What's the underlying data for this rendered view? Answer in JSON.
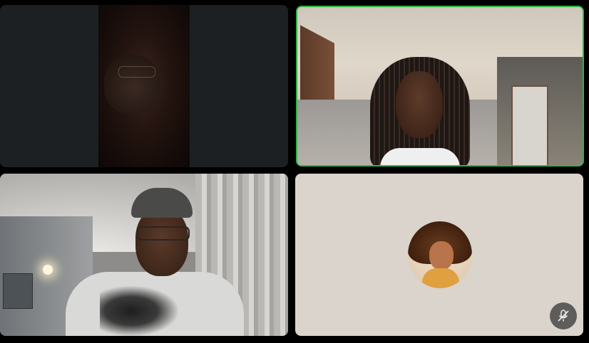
{
  "call": {
    "layout": "2x2 gallery",
    "active_speaker_color": "#2fb344",
    "tiles": [
      {
        "id": "participant-1",
        "video": "on",
        "state": "dark room"
      },
      {
        "id": "participant-2",
        "video": "on",
        "state": "speaking"
      },
      {
        "id": "participant-3",
        "video": "on",
        "state": "normal"
      },
      {
        "id": "participant-4",
        "video": "off",
        "avatar": "profile-avatar",
        "icon": "mic-muted-icon"
      }
    ]
  }
}
